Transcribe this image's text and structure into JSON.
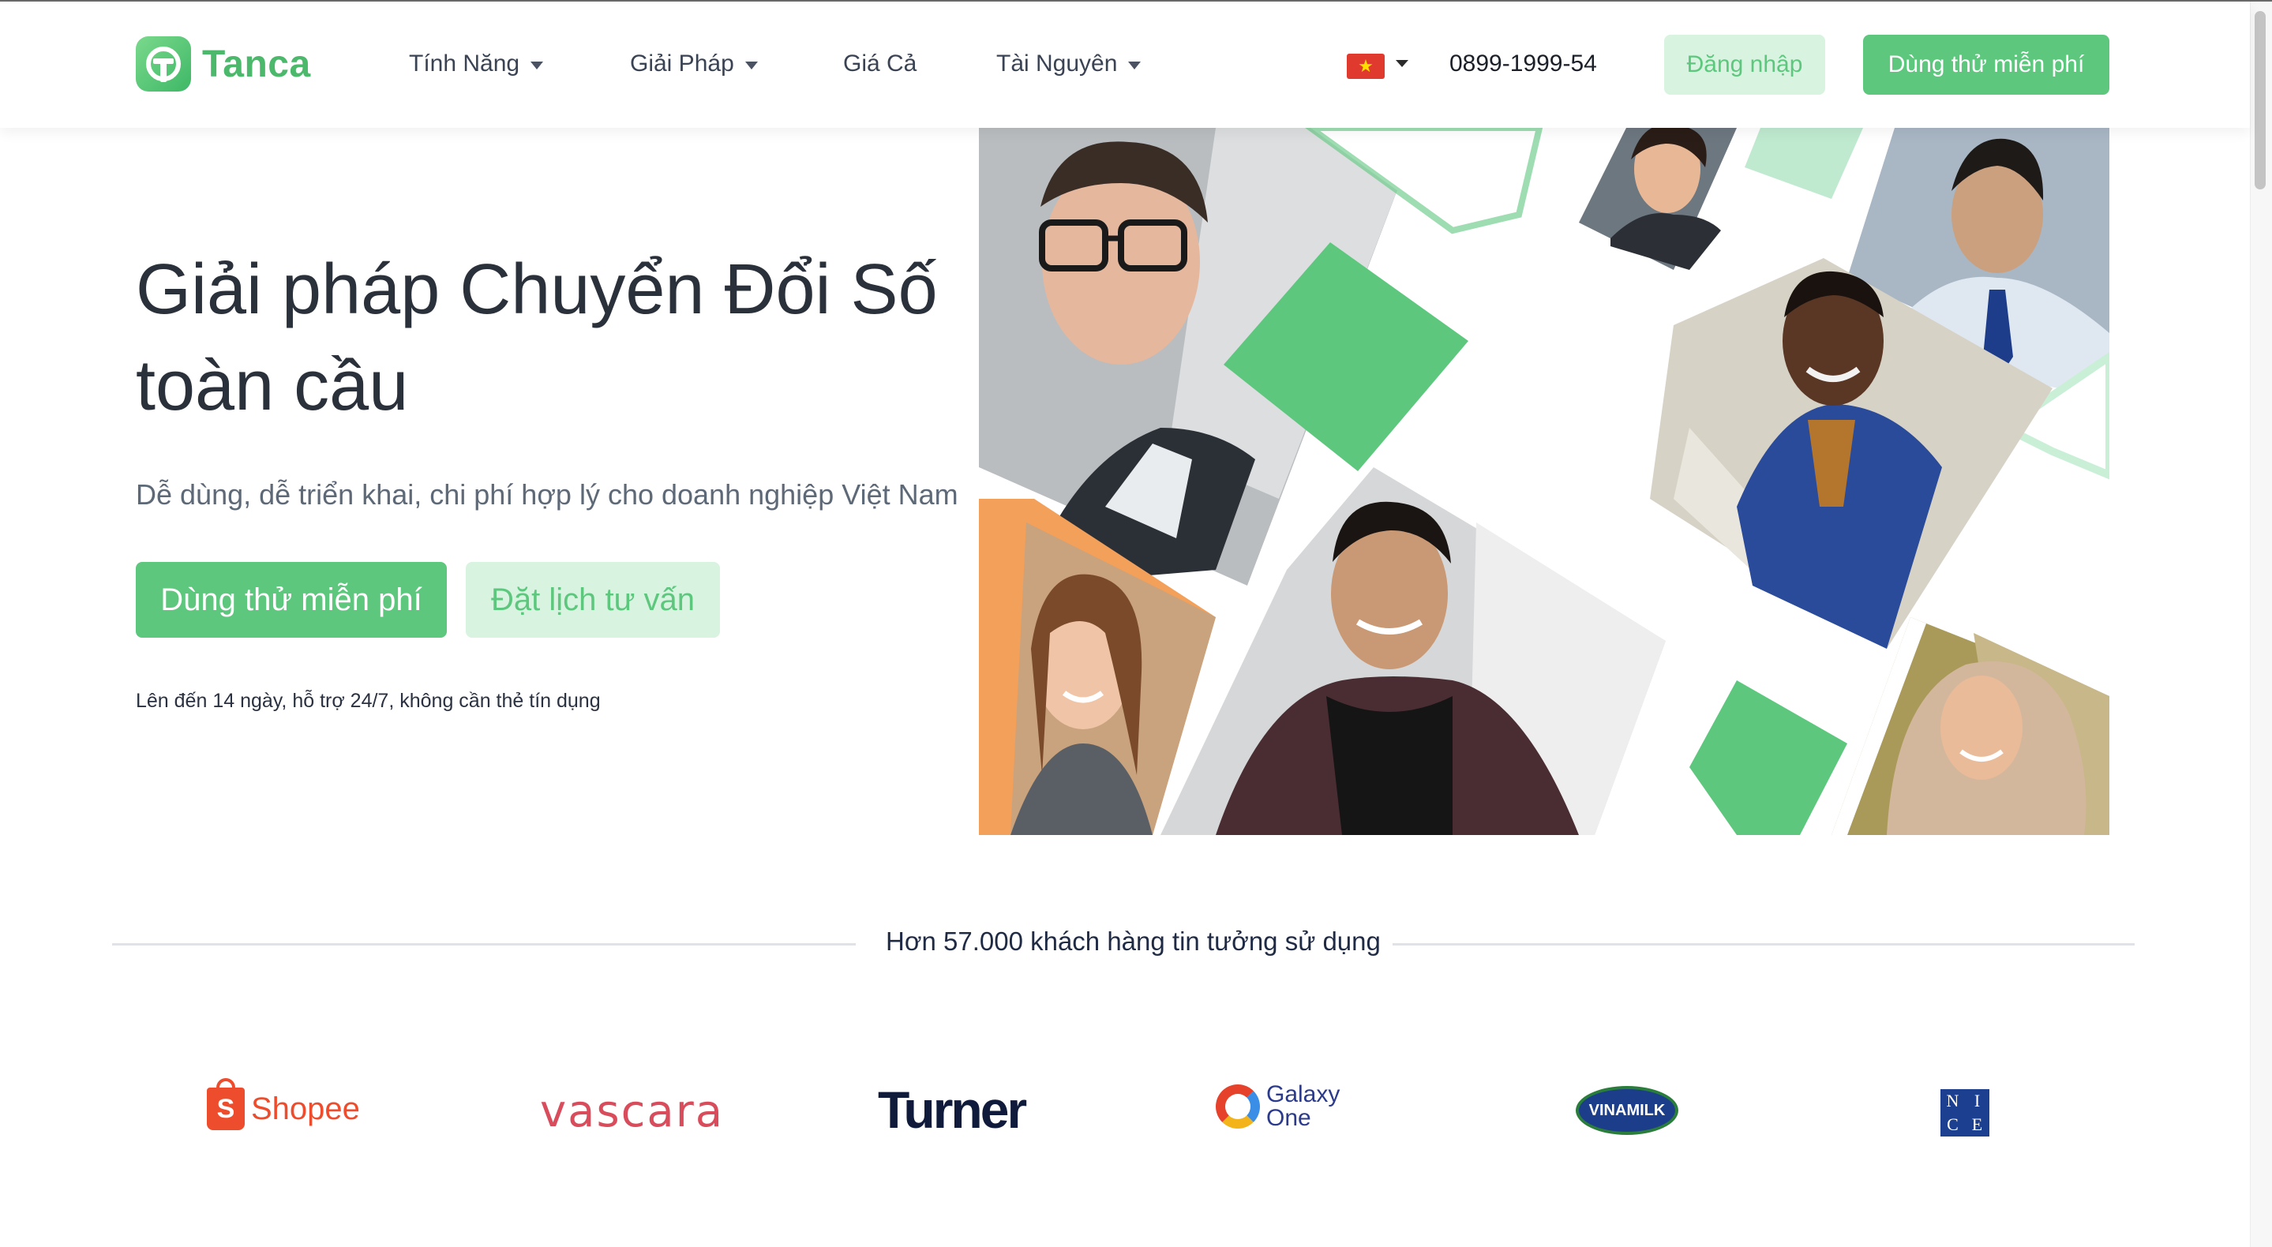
{
  "brand": {
    "name": "Tanca",
    "accent": "#5cc77d",
    "accent_light": "#d8f3e0"
  },
  "nav": {
    "items": [
      {
        "label": "Tính Năng",
        "has_dropdown": true
      },
      {
        "label": "Giải Pháp",
        "has_dropdown": true
      },
      {
        "label": "Giá Cả",
        "has_dropdown": false
      },
      {
        "label": "Tài Nguyên",
        "has_dropdown": true
      }
    ],
    "language_flag": "vietnam-flag-icon",
    "phone": "0899-1999-54",
    "login_label": "Đăng nhập",
    "trial_label": "Dùng thử miễn phí"
  },
  "hero": {
    "title_line1": "Giải pháp Chuyển Đổi Số",
    "title_line2": "toàn cầu",
    "subtitle": "Dễ dùng, dễ triển khai, chi phí hợp lý cho doanh nghiệp Việt Nam",
    "primary_cta": "Dùng thử miễn phí",
    "secondary_cta": "Đặt lịch tư vấn",
    "note": "Lên đến 14 ngày, hỗ trợ 24/7, không cần thẻ tín dụng"
  },
  "trust": {
    "text": "Hơn 57.000 khách hàng tin tưởng sử dụng",
    "logos": {
      "shopee": "Shopee",
      "vascara": "vascara",
      "turner": "Turner",
      "galaxy_line1": "Galaxy",
      "galaxy_line2": "One",
      "vinamilk": "VINAMILK",
      "nice": [
        "N",
        "I",
        "C",
        "E"
      ]
    }
  }
}
